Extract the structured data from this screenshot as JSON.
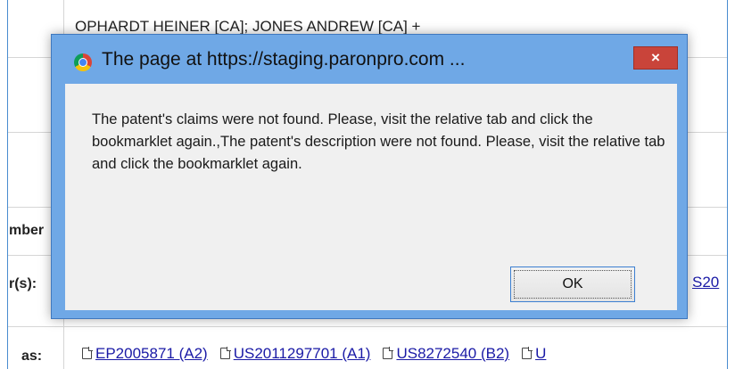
{
  "background": {
    "inventors_text": "OPHARDT HEINER [CA]; JONES ANDREW [CA] +",
    "row_label_number": "mber",
    "row_label_applicants": "r(s):",
    "row_label_also": "as:",
    "applicant_link_partial": "S20",
    "also_published": [
      {
        "label": "EP2005871 (A2)"
      },
      {
        "label": "US2011297701 (A1)"
      },
      {
        "label": "US8272540 (B2)"
      },
      {
        "label": "U"
      }
    ]
  },
  "dialog": {
    "title": "The page at https://staging.paronpro.com ...",
    "close_label": "×",
    "message": "The patent's claims were not found. Please, visit the relative tab and click the bookmarklet again.,The patent's description were not found. Please, visit the relative tab and click the bookmarklet again.",
    "ok_label": "OK"
  },
  "colors": {
    "dialog_frame": "#6fa8e6",
    "close_button": "#c9443a",
    "client_bg": "#f0f0f0",
    "link": "#1a1aa6"
  }
}
